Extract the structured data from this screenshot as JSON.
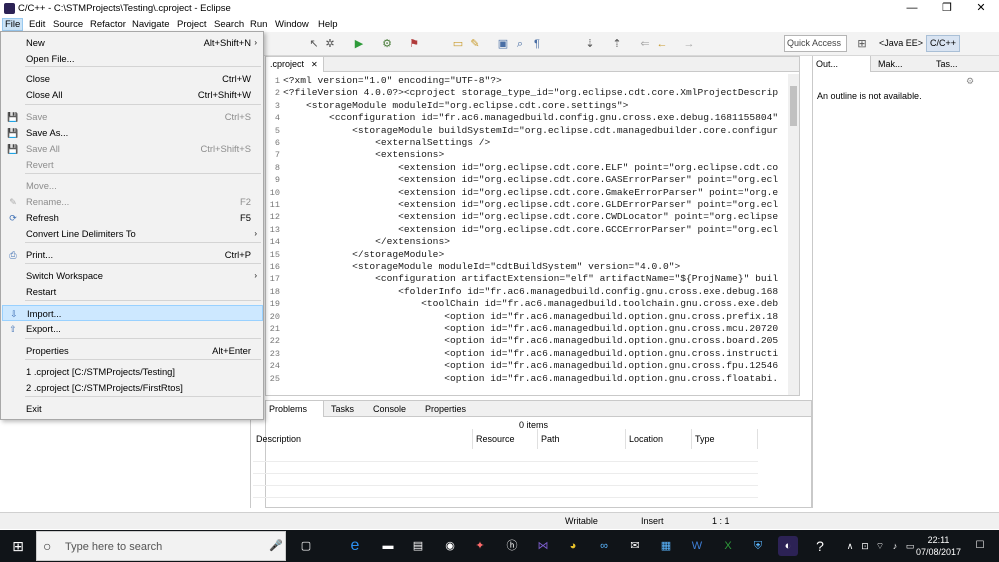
{
  "window": {
    "title": "C/C++ - C:\\STMProjects\\Testing\\.cproject - Eclipse",
    "minimize_glyph": "—",
    "restore_glyph": "❐",
    "close_glyph": "✕"
  },
  "menubar": [
    "File",
    "Edit",
    "Source",
    "Refactor",
    "Navigate",
    "Project",
    "Search",
    "Run",
    "Window",
    "Help"
  ],
  "toolbar": {
    "quick_access": "Quick Access",
    "perspectives": [
      "<Java EE>",
      "C/C++"
    ]
  },
  "file_menu": {
    "items": [
      {
        "label": "New",
        "shortcut": "Alt+Shift+N",
        "submenu": true,
        "disabled": false
      },
      {
        "label": "Open File...",
        "shortcut": "",
        "submenu": false,
        "disabled": false
      },
      {
        "label": "Close",
        "shortcut": "Ctrl+W",
        "submenu": false,
        "disabled": false
      },
      {
        "label": "Close All",
        "shortcut": "Ctrl+Shift+W",
        "submenu": false,
        "disabled": false
      },
      {
        "label": "Save",
        "shortcut": "Ctrl+S",
        "submenu": false,
        "disabled": true
      },
      {
        "label": "Save As...",
        "shortcut": "",
        "submenu": false,
        "disabled": false
      },
      {
        "label": "Save All",
        "shortcut": "Ctrl+Shift+S",
        "submenu": false,
        "disabled": true
      },
      {
        "label": "Revert",
        "shortcut": "",
        "submenu": false,
        "disabled": true
      },
      {
        "label": "Move...",
        "shortcut": "",
        "submenu": false,
        "disabled": true
      },
      {
        "label": "Rename...",
        "shortcut": "F2",
        "submenu": false,
        "disabled": true
      },
      {
        "label": "Refresh",
        "shortcut": "F5",
        "submenu": false,
        "disabled": false
      },
      {
        "label": "Convert Line Delimiters To",
        "shortcut": "",
        "submenu": true,
        "disabled": false
      },
      {
        "label": "Print...",
        "shortcut": "Ctrl+P",
        "submenu": false,
        "disabled": false
      },
      {
        "label": "Switch Workspace",
        "shortcut": "",
        "submenu": true,
        "disabled": false
      },
      {
        "label": "Restart",
        "shortcut": "",
        "submenu": false,
        "disabled": false
      },
      {
        "label": "Import...",
        "shortcut": "",
        "submenu": false,
        "disabled": false,
        "highlighted": true
      },
      {
        "label": "Export...",
        "shortcut": "",
        "submenu": false,
        "disabled": false
      },
      {
        "label": "Properties",
        "shortcut": "Alt+Enter",
        "submenu": false,
        "disabled": false
      },
      {
        "label": "1 .cproject  [C:/STMProjects/Testing]",
        "shortcut": "",
        "submenu": false,
        "disabled": false
      },
      {
        "label": "2 .cproject  [C:/STMProjects/FirstRtos]",
        "shortcut": "",
        "submenu": false,
        "disabled": false
      },
      {
        "label": "Exit",
        "shortcut": "",
        "submenu": false,
        "disabled": false
      }
    ]
  },
  "editor": {
    "tab_label": ".cproject",
    "lines": [
      "<?xml version=\"1.0\" encoding=\"UTF-8\"?>",
      "<?fileVersion 4.0.0?><cproject storage_type_id=\"org.eclipse.cdt.core.XmlProjectDescrip",
      "    <storageModule moduleId=\"org.eclipse.cdt.core.settings\">",
      "        <cconfiguration id=\"fr.ac6.managedbuild.config.gnu.cross.exe.debug.1681155804\"",
      "            <storageModule buildSystemId=\"org.eclipse.cdt.managedbuilder.core.configur",
      "                <externalSettings />",
      "                <extensions>",
      "                    <extension id=\"org.eclipse.cdt.core.ELF\" point=\"org.eclipse.cdt.co",
      "                    <extension id=\"org.eclipse.cdt.core.GASErrorParser\" point=\"org.ecl",
      "                    <extension id=\"org.eclipse.cdt.core.GmakeErrorParser\" point=\"org.e",
      "                    <extension id=\"org.eclipse.cdt.core.GLDErrorParser\" point=\"org.ecl",
      "                    <extension id=\"org.eclipse.cdt.core.CWDLocator\" point=\"org.eclipse",
      "                    <extension id=\"org.eclipse.cdt.core.GCCErrorParser\" point=\"org.ecl",
      "                </extensions>",
      "            </storageModule>",
      "            <storageModule moduleId=\"cdtBuildSystem\" version=\"4.0.0\">",
      "                <configuration artifactExtension=\"elf\" artifactName=\"${ProjName}\" buil",
      "                    <folderInfo id=\"fr.ac6.managedbuild.config.gnu.cross.exe.debug.168",
      "                        <toolChain id=\"fr.ac6.managedbuild.toolchain.gnu.cross.exe.deb",
      "                            <option id=\"fr.ac6.managedbuild.option.gnu.cross.prefix.18",
      "                            <option id=\"fr.ac6.managedbuild.option.gnu.cross.mcu.20720",
      "                            <option id=\"fr.ac6.managedbuild.option.gnu.cross.board.205",
      "                            <option id=\"fr.ac6.managedbuild.option.gnu.cross.instructi",
      "                            <option id=\"fr.ac6.managedbuild.option.gnu.cross.fpu.12546",
      "                            <option id=\"fr.ac6.managedbuild.option.gnu.cross.floatabi."
    ],
    "line_numbers": [
      "1",
      "2",
      "3",
      "4",
      "5",
      "6",
      "7",
      "8",
      "9",
      "10",
      "11",
      "12",
      "13",
      "14",
      "15",
      "16",
      "17",
      "18",
      "19",
      "20",
      "21",
      "22",
      "23",
      "24",
      "25"
    ]
  },
  "outline": {
    "tabs": [
      "Out...",
      "Mak...",
      "Tas..."
    ],
    "message": "An outline is not available."
  },
  "problems": {
    "tabs": [
      "Problems",
      "Tasks",
      "Console",
      "Properties"
    ],
    "count_text": "0 items",
    "columns": [
      "Description",
      "Resource",
      "Path",
      "Location",
      "Type"
    ]
  },
  "statusbar": {
    "mode": "Writable",
    "insert": "Insert",
    "position": "1 : 1"
  },
  "taskbar": {
    "search_placeholder": "Type here to search",
    "time": "22:11",
    "date": "07/08/2017"
  },
  "colors": {
    "menu_highlight": "#cde8ff",
    "taskbar_bg": "#101418",
    "perspective_active": "#d9e4f2"
  }
}
